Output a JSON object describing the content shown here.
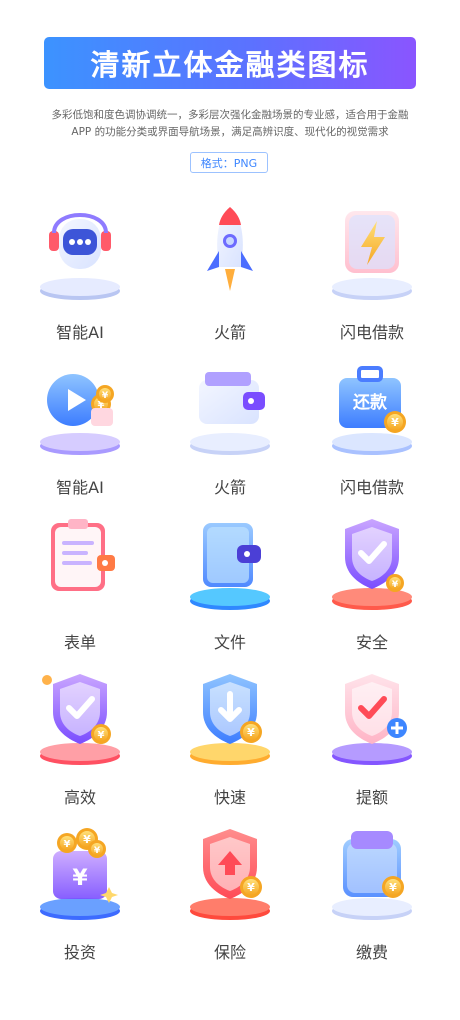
{
  "header": {
    "title": "清新立体金融类图标",
    "description_line1": "多彩低饱和度色调协调统一，多彩层次强化金融场景的专业感，适合用于金融",
    "description_line2": "APP 的功能分类或界面导航场景，满足高辨识度、现代化的视觉需求",
    "format": "格式：PNG"
  },
  "icons": [
    {
      "label": "智能AI",
      "icon": "ai-robot-icon"
    },
    {
      "label": "火箭",
      "icon": "rocket-icon"
    },
    {
      "label": "闪电借款",
      "icon": "lightning-icon"
    },
    {
      "label": "智能AI",
      "icon": "play-coins-icon"
    },
    {
      "label": "火箭",
      "icon": "wallet-icon"
    },
    {
      "label": "闪电借款",
      "icon": "repay-briefcase-icon",
      "badge_text": "还款"
    },
    {
      "label": "表单",
      "icon": "clipboard-form-icon"
    },
    {
      "label": "文件",
      "icon": "file-wallet-icon"
    },
    {
      "label": "安全",
      "icon": "shield-check-icon"
    },
    {
      "label": "高效",
      "icon": "shield-check-coin-icon"
    },
    {
      "label": "快速",
      "icon": "shield-download-icon"
    },
    {
      "label": "提额",
      "icon": "shield-plus-icon"
    },
    {
      "label": "投资",
      "icon": "coin-pot-icon"
    },
    {
      "label": "保险",
      "icon": "shield-up-icon"
    },
    {
      "label": "缴费",
      "icon": "payment-box-icon"
    }
  ],
  "colors": {
    "banner_start": "#3c93ff",
    "banner_end": "#8a55ff",
    "accent": "#3d86ff"
  }
}
